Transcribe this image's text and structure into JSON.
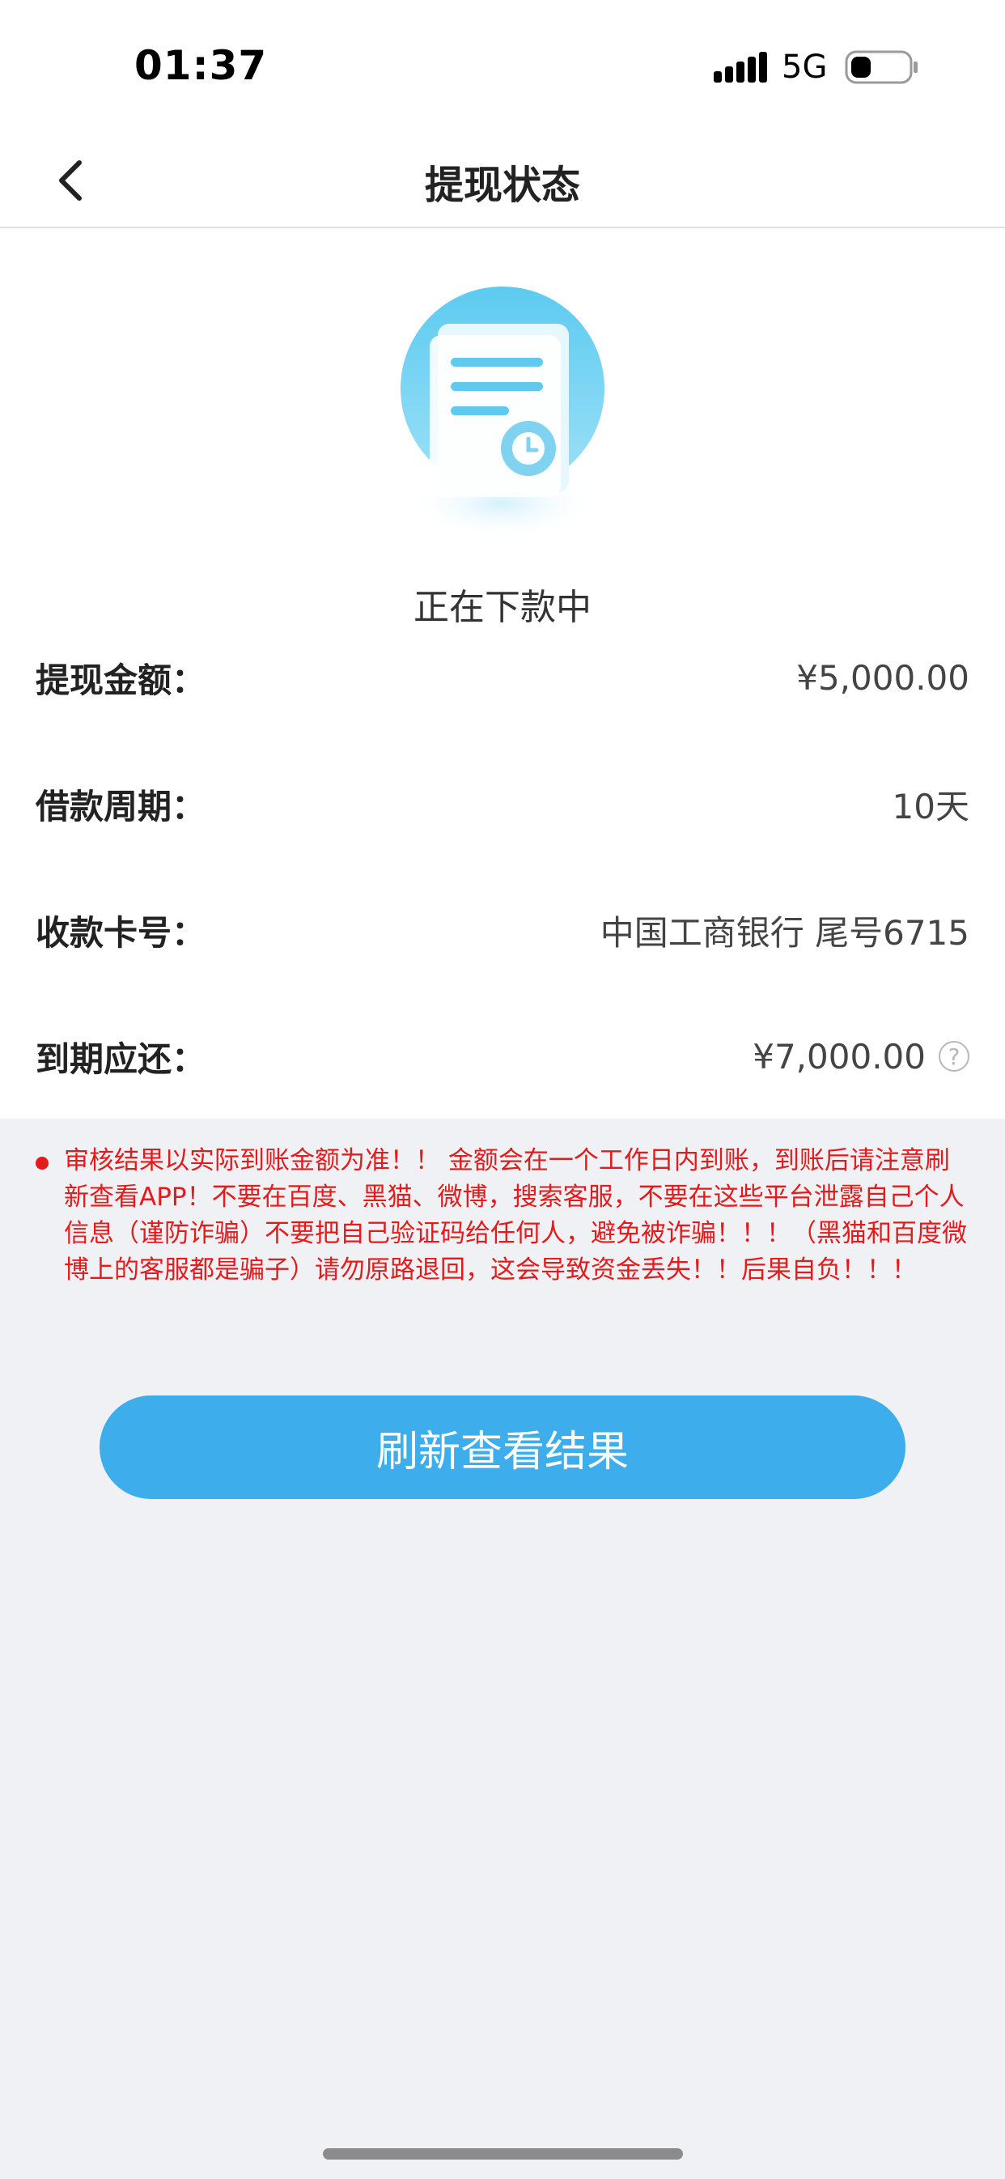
{
  "status_bar": {
    "time": "01:37",
    "network": "5G",
    "icons": [
      "signal-bars-icon",
      "battery-icon"
    ]
  },
  "header": {
    "title": "提现状态",
    "back_icon": "chevron-left-icon"
  },
  "status": {
    "icon": "document-clock-icon",
    "text": "正在下款中"
  },
  "details": [
    {
      "label": "提现金额：",
      "value": "¥5,000.00"
    },
    {
      "label": "借款周期：",
      "value": "10天"
    },
    {
      "label": "收款卡号：",
      "value": "中国工商银行 尾号6715"
    },
    {
      "label": "到期应还：",
      "value": "¥7,000.00",
      "icon": "question-circle-icon"
    }
  ],
  "notice": {
    "text": "审核结果以实际到账金额为准！！ 金额会在一个工作日内到账，到账后请注意刷新查看APP！不要在百度、黑猫、微博，搜索客服，不要在这些平台泄露自己个人信息（谨防诈骗）不要把自己验证码给任何人，避免被诈骗！！！（黑猫和百度微博上的客服都是骗子）请勿原路退回，这会导致资金丢失！！后果自负！！！"
  },
  "refresh_button": {
    "label": "刷新查看结果"
  },
  "colors": {
    "accent": "#3eadec",
    "warning": "#e51b1b",
    "background": "#f0f1f5"
  }
}
